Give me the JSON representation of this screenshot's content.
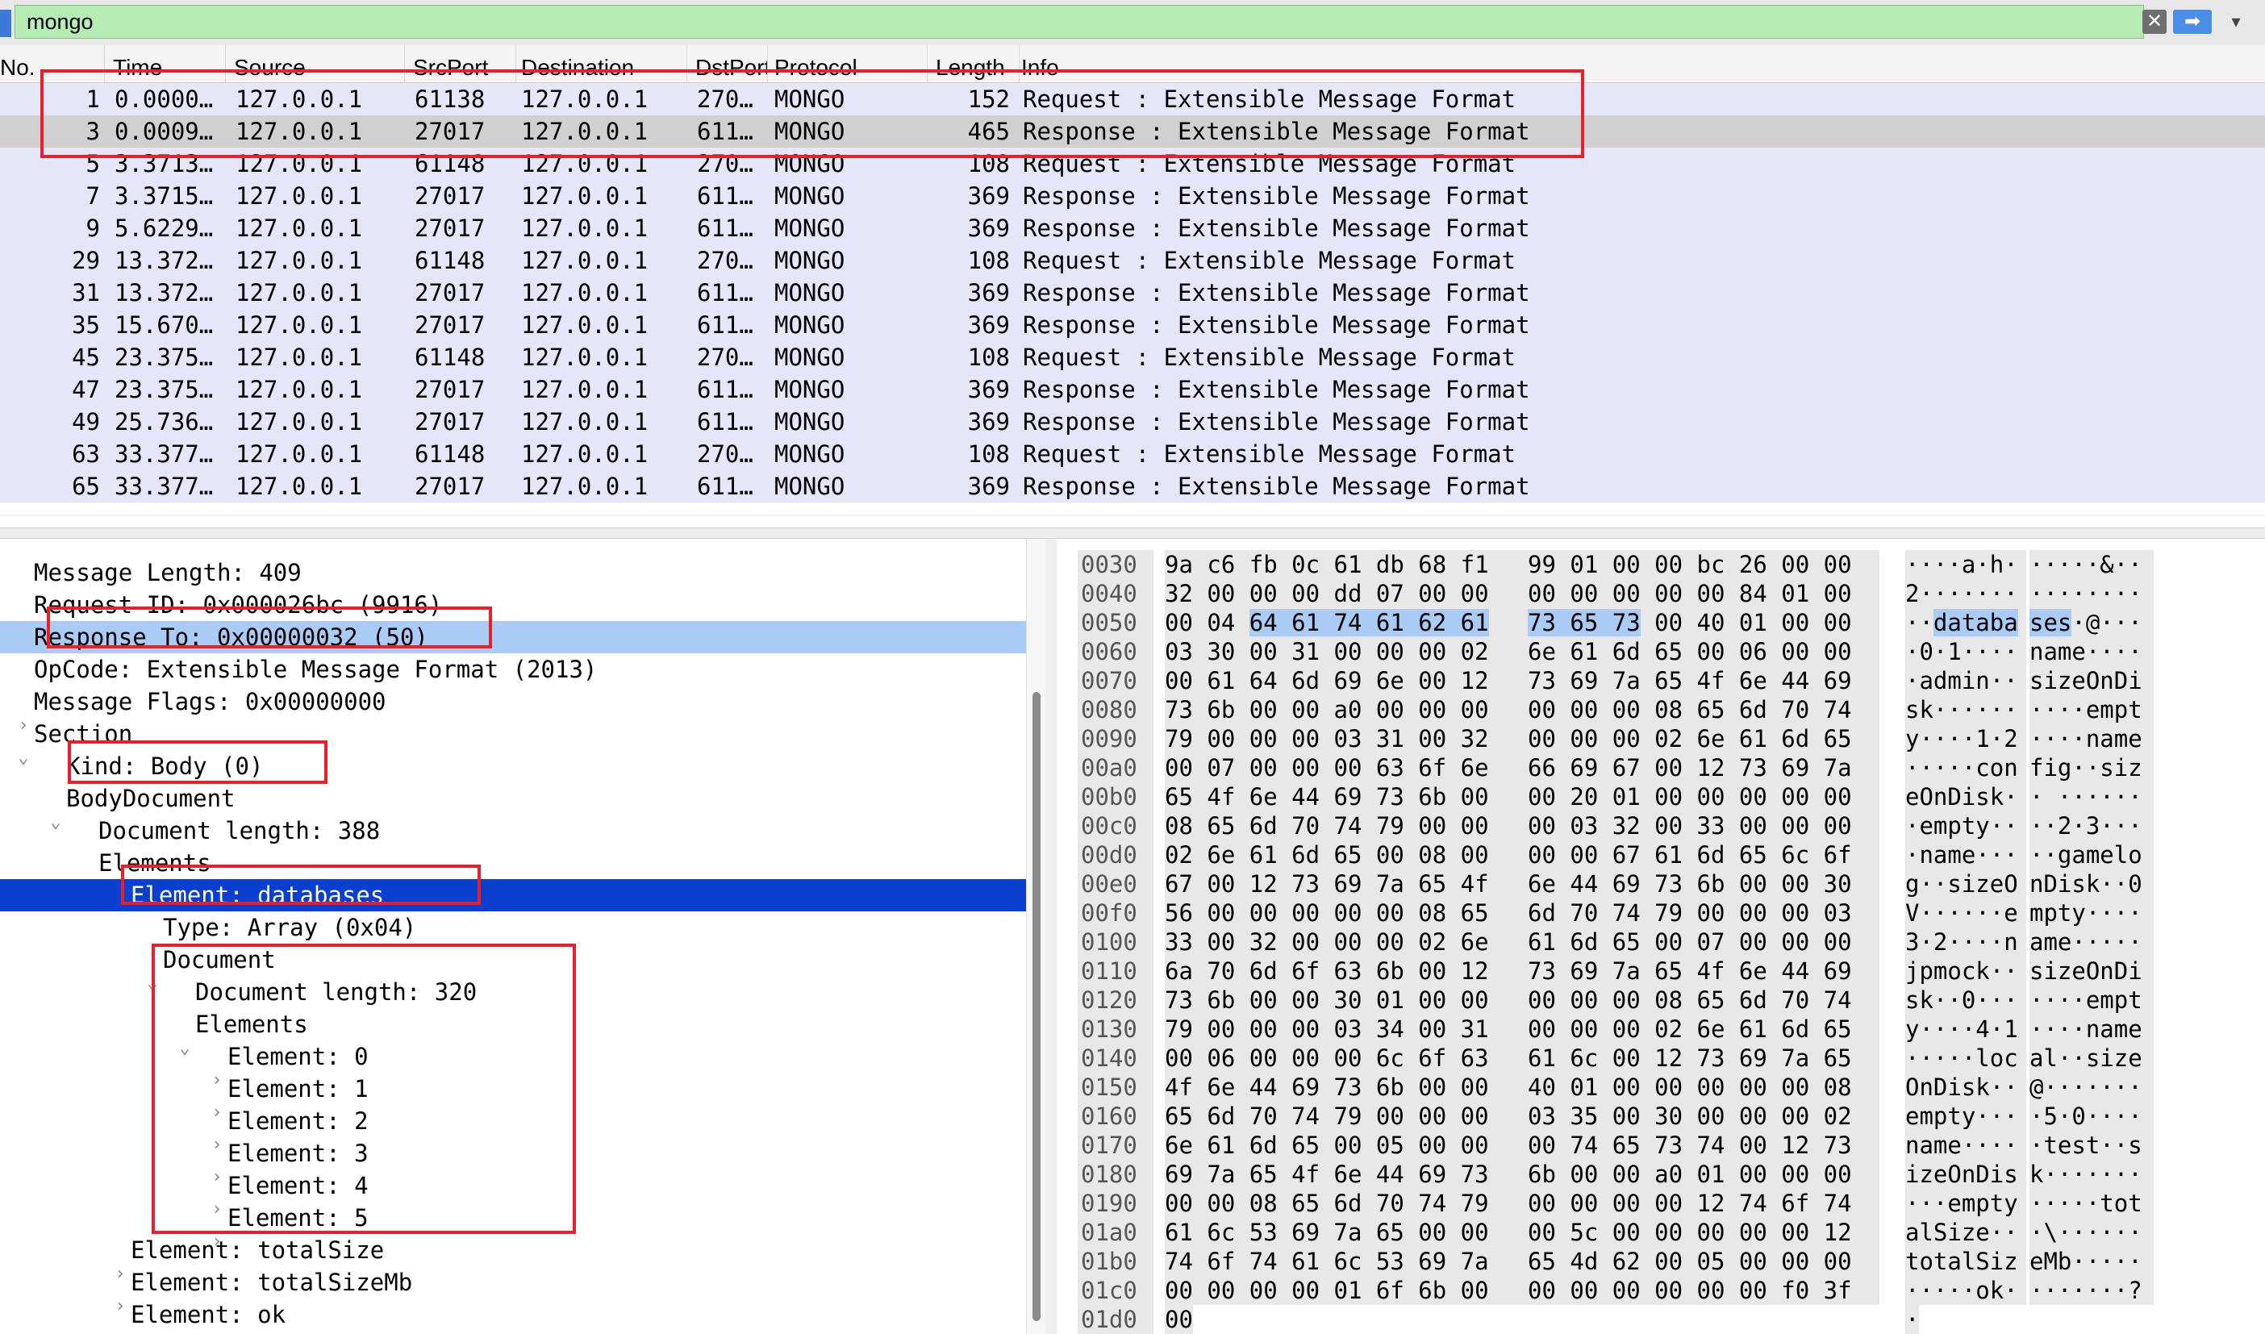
{
  "filter": {
    "value": "mongo",
    "clear_icon": "✕",
    "apply_icon": "➡",
    "dropdown_icon": "▾"
  },
  "columns": [
    "No.",
    "Time",
    "Source",
    "SrcPort",
    "Destination",
    "DstPort",
    "Protocol",
    "Length",
    "Info"
  ],
  "packets": [
    {
      "no": "1",
      "time": "0.0000…",
      "src": "127.0.0.1",
      "sport": "61138",
      "dst": "127.0.0.1",
      "dport": "270…",
      "proto": "MONGO",
      "len": "152",
      "info": "Request : Extensible Message Format"
    },
    {
      "no": "3",
      "time": "0.0009…",
      "src": "127.0.0.1",
      "sport": "27017",
      "dst": "127.0.0.1",
      "dport": "611…",
      "proto": "MONGO",
      "len": "465",
      "info": "Response : Extensible Message Format"
    },
    {
      "no": "5",
      "time": "3.3713…",
      "src": "127.0.0.1",
      "sport": "61148",
      "dst": "127.0.0.1",
      "dport": "270…",
      "proto": "MONGO",
      "len": "108",
      "info": "Request : Extensible Message Format"
    },
    {
      "no": "7",
      "time": "3.3715…",
      "src": "127.0.0.1",
      "sport": "27017",
      "dst": "127.0.0.1",
      "dport": "611…",
      "proto": "MONGO",
      "len": "369",
      "info": "Response : Extensible Message Format"
    },
    {
      "no": "9",
      "time": "5.6229…",
      "src": "127.0.0.1",
      "sport": "27017",
      "dst": "127.0.0.1",
      "dport": "611…",
      "proto": "MONGO",
      "len": "369",
      "info": "Response : Extensible Message Format"
    },
    {
      "no": "29",
      "time": "13.372…",
      "src": "127.0.0.1",
      "sport": "61148",
      "dst": "127.0.0.1",
      "dport": "270…",
      "proto": "MONGO",
      "len": "108",
      "info": "Request : Extensible Message Format"
    },
    {
      "no": "31",
      "time": "13.372…",
      "src": "127.0.0.1",
      "sport": "27017",
      "dst": "127.0.0.1",
      "dport": "611…",
      "proto": "MONGO",
      "len": "369",
      "info": "Response : Extensible Message Format"
    },
    {
      "no": "35",
      "time": "15.670…",
      "src": "127.0.0.1",
      "sport": "27017",
      "dst": "127.0.0.1",
      "dport": "611…",
      "proto": "MONGO",
      "len": "369",
      "info": "Response : Extensible Message Format"
    },
    {
      "no": "45",
      "time": "23.375…",
      "src": "127.0.0.1",
      "sport": "61148",
      "dst": "127.0.0.1",
      "dport": "270…",
      "proto": "MONGO",
      "len": "108",
      "info": "Request : Extensible Message Format"
    },
    {
      "no": "47",
      "time": "23.375…",
      "src": "127.0.0.1",
      "sport": "27017",
      "dst": "127.0.0.1",
      "dport": "611…",
      "proto": "MONGO",
      "len": "369",
      "info": "Response : Extensible Message Format"
    },
    {
      "no": "49",
      "time": "25.736…",
      "src": "127.0.0.1",
      "sport": "27017",
      "dst": "127.0.0.1",
      "dport": "611…",
      "proto": "MONGO",
      "len": "369",
      "info": "Response : Extensible Message Format"
    },
    {
      "no": "63",
      "time": "33.377…",
      "src": "127.0.0.1",
      "sport": "61148",
      "dst": "127.0.0.1",
      "dport": "270…",
      "proto": "MONGO",
      "len": "108",
      "info": "Request : Extensible Message Format"
    },
    {
      "no": "65",
      "time": "33.377…",
      "src": "127.0.0.1",
      "sport": "27017",
      "dst": "127.0.0.1",
      "dport": "611…",
      "proto": "MONGO",
      "len": "369",
      "info": "Response : Extensible Message Format"
    }
  ],
  "selected_packet_index": 1,
  "details": [
    {
      "indent": 0,
      "chev": "",
      "text": "Message Length: 409"
    },
    {
      "indent": 0,
      "chev": "",
      "text": "Request ID: 0x000026bc (9916)"
    },
    {
      "indent": 0,
      "chev": "",
      "text": "Response To: 0x00000032 (50)",
      "state": "hl"
    },
    {
      "indent": 0,
      "chev": "",
      "text": "OpCode: Extensible Message Format (2013)"
    },
    {
      "indent": 0,
      "chev": "›",
      "text": "Message Flags: 0x00000000"
    },
    {
      "indent": 0,
      "chev": "⌄",
      "text": "Section"
    },
    {
      "indent": 1,
      "chev": "",
      "text": "Kind: Body (0)"
    },
    {
      "indent": 1,
      "chev": "⌄",
      "text": "BodyDocument"
    },
    {
      "indent": 2,
      "chev": "",
      "text": "Document length: 388"
    },
    {
      "indent": 2,
      "chev": "⌄",
      "text": "Elements"
    },
    {
      "indent": 3,
      "chev": "⌄",
      "text": "Element: databases",
      "state": "sel"
    },
    {
      "indent": 4,
      "chev": "",
      "text": "Type: Array (0x04)"
    },
    {
      "indent": 4,
      "chev": "⌄",
      "text": "Document"
    },
    {
      "indent": 5,
      "chev": "",
      "text": "Document length: 320"
    },
    {
      "indent": 5,
      "chev": "⌄",
      "text": "Elements"
    },
    {
      "indent": 6,
      "chev": "›",
      "text": "Element: 0"
    },
    {
      "indent": 6,
      "chev": "›",
      "text": "Element: 1"
    },
    {
      "indent": 6,
      "chev": "›",
      "text": "Element: 2"
    },
    {
      "indent": 6,
      "chev": "›",
      "text": "Element: 3"
    },
    {
      "indent": 6,
      "chev": "›",
      "text": "Element: 4"
    },
    {
      "indent": 6,
      "chev": "›",
      "text": "Element: 5"
    },
    {
      "indent": 3,
      "chev": "›",
      "text": "Element: totalSize"
    },
    {
      "indent": 3,
      "chev": "›",
      "text": "Element: totalSizeMb"
    },
    {
      "indent": 3,
      "chev": "›",
      "text": "Element: ok"
    }
  ],
  "bytes": [
    {
      "off": "0030",
      "h1": "9a c6 fb 0c 61 db 68 f1",
      "h2": "99 01 00 00 bc 26 00 00",
      "a1": "····a·h·",
      "a2": "·····&··"
    },
    {
      "off": "0040",
      "h1": "32 00 00 00 dd 07 00 00",
      "h2": "00 00 00 00 00 84 01 00",
      "a1": "2·······",
      "a2": "········"
    },
    {
      "off": "0050",
      "h1": "00 04 64 61 74 61 62 61",
      "h2": "73 65 73 00 40 01 00 00",
      "a1": "··databa",
      "a2": "ses·@···",
      "hl": true
    },
    {
      "off": "0060",
      "h1": "03 30 00 31 00 00 00 02",
      "h2": "6e 61 6d 65 00 06 00 00",
      "a1": "·0·1····",
      "a2": "name····"
    },
    {
      "off": "0070",
      "h1": "00 61 64 6d 69 6e 00 12",
      "h2": "73 69 7a 65 4f 6e 44 69",
      "a1": "·admin··",
      "a2": "sizeOnDi"
    },
    {
      "off": "0080",
      "h1": "73 6b 00 00 a0 00 00 00",
      "h2": "00 00 00 08 65 6d 70 74",
      "a1": "sk······",
      "a2": "····empt"
    },
    {
      "off": "0090",
      "h1": "79 00 00 00 03 31 00 32",
      "h2": "00 00 00 02 6e 61 6d 65",
      "a1": "y····1·2",
      "a2": "····name"
    },
    {
      "off": "00a0",
      "h1": "00 07 00 00 00 63 6f 6e",
      "h2": "66 69 67 00 12 73 69 7a",
      "a1": "·····con",
      "a2": "fig··siz"
    },
    {
      "off": "00b0",
      "h1": "65 4f 6e 44 69 73 6b 00",
      "h2": "00 20 01 00 00 00 00 00",
      "a1": "eOnDisk·",
      "a2": "· ······"
    },
    {
      "off": "00c0",
      "h1": "08 65 6d 70 74 79 00 00",
      "h2": "00 03 32 00 33 00 00 00",
      "a1": "·empty··",
      "a2": "··2·3···"
    },
    {
      "off": "00d0",
      "h1": "02 6e 61 6d 65 00 08 00",
      "h2": "00 00 67 61 6d 65 6c 6f",
      "a1": "·name···",
      "a2": "··gamelo"
    },
    {
      "off": "00e0",
      "h1": "67 00 12 73 69 7a 65 4f",
      "h2": "6e 44 69 73 6b 00 00 30",
      "a1": "g··sizeO",
      "a2": "nDisk··0"
    },
    {
      "off": "00f0",
      "h1": "56 00 00 00 00 00 08 65",
      "h2": "6d 70 74 79 00 00 00 03",
      "a1": "V······e",
      "a2": "mpty····"
    },
    {
      "off": "0100",
      "h1": "33 00 32 00 00 00 02 6e",
      "h2": "61 6d 65 00 07 00 00 00",
      "a1": "3·2····n",
      "a2": "ame·····"
    },
    {
      "off": "0110",
      "h1": "6a 70 6d 6f 63 6b 00 12",
      "h2": "73 69 7a 65 4f 6e 44 69",
      "a1": "jpmock··",
      "a2": "sizeOnDi"
    },
    {
      "off": "0120",
      "h1": "73 6b 00 00 30 01 00 00",
      "h2": "00 00 00 08 65 6d 70 74",
      "a1": "sk··0···",
      "a2": "····empt"
    },
    {
      "off": "0130",
      "h1": "79 00 00 00 03 34 00 31",
      "h2": "00 00 00 02 6e 61 6d 65",
      "a1": "y····4·1",
      "a2": "····name"
    },
    {
      "off": "0140",
      "h1": "00 06 00 00 00 6c 6f 63",
      "h2": "61 6c 00 12 73 69 7a 65",
      "a1": "·····loc",
      "a2": "al··size"
    },
    {
      "off": "0150",
      "h1": "4f 6e 44 69 73 6b 00 00",
      "h2": "40 01 00 00 00 00 00 08",
      "a1": "OnDisk··",
      "a2": "@·······"
    },
    {
      "off": "0160",
      "h1": "65 6d 70 74 79 00 00 00",
      "h2": "03 35 00 30 00 00 00 02",
      "a1": "empty···",
      "a2": "·5·0····"
    },
    {
      "off": "0170",
      "h1": "6e 61 6d 65 00 05 00 00",
      "h2": "00 74 65 73 74 00 12 73",
      "a1": "name····",
      "a2": "·test··s"
    },
    {
      "off": "0180",
      "h1": "69 7a 65 4f 6e 44 69 73",
      "h2": "6b 00 00 a0 01 00 00 00",
      "a1": "izeOnDis",
      "a2": "k·······"
    },
    {
      "off": "0190",
      "h1": "00 00 08 65 6d 70 74 79",
      "h2": "00 00 00 00 12 74 6f 74",
      "a1": "···empty",
      "a2": "·····tot"
    },
    {
      "off": "01a0",
      "h1": "61 6c 53 69 7a 65 00 00",
      "h2": "00 5c 00 00 00 00 00 12",
      "a1": "alSize··",
      "a2": "·\\······"
    },
    {
      "off": "01b0",
      "h1": "74 6f 74 61 6c 53 69 7a",
      "h2": "65 4d 62 00 05 00 00 00",
      "a1": "totalSiz",
      "a2": "eMb·····"
    },
    {
      "off": "01c0",
      "h1": "00 00 00 00 01 6f 6b 00",
      "h2": "00 00 00 00 00 00 f0 3f",
      "a1": "·····ok·",
      "a2": "·······?"
    },
    {
      "off": "01d0",
      "h1": "00",
      "h2": "",
      "a1": "·",
      "a2": ""
    }
  ],
  "colors": {
    "row_bg": "#e6e6fa",
    "row_selected": "#d0d0d0",
    "detail_selected": "#0a3fd0",
    "highlight": "#a9cbf5",
    "annotation": "#e8202a",
    "filter_valid": "#b4ecb4"
  }
}
